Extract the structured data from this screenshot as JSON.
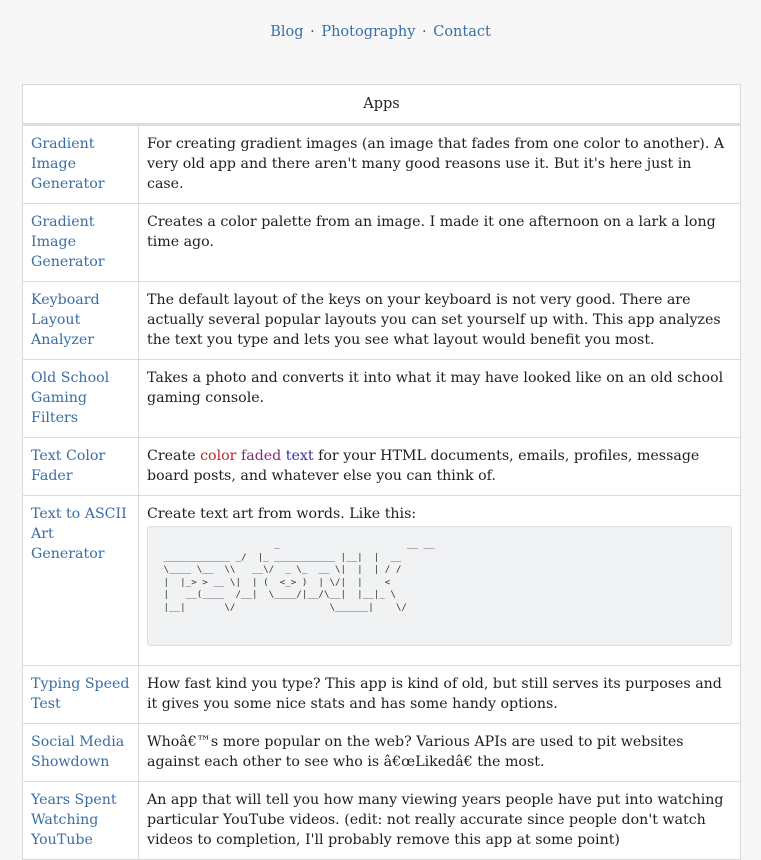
{
  "nav": {
    "links": [
      "Blog",
      "Photography",
      "Contact"
    ],
    "separator": "·"
  },
  "table": {
    "header": "Apps",
    "rows": [
      {
        "name": "Gradient Image Generator",
        "description": "For creating gradient images (an image that fades from one color to another). A very old app and there aren't many good reasons use it. But it's here just in case."
      },
      {
        "name": "Gradient Image Generator",
        "description": "Creates a color palette from an image. I made it one afternoon on a lark a long time ago."
      },
      {
        "name": "Keyboard Layout Analyzer",
        "description": "The default layout of the keys on your keyboard is not very good. There are actually several popular layouts you can set yourself up with. This app analyzes the text you type and lets you see what layout would benefit you most."
      },
      {
        "name": "Old School Gaming Filters",
        "description": "Takes a photo and converts it into what it may have looked like on an old school gaming console."
      },
      {
        "name": "Text Color Fader",
        "description_prefix": "Create ",
        "description_fade": [
          "color",
          "faded",
          "text"
        ],
        "description_suffix": " for your HTML documents, emails, profiles, message board posts, and whatever else you can think of."
      },
      {
        "name": "Text to ASCII Art Generator",
        "description": "Create text art from words. Like this:",
        "ascii_art": "                     _                       __ __\n ____________ _/  |_ ___________ |__|  |  __\n \\____ \\__  \\\\   __\\/  _ \\_  __ \\|  |  | / /\n |  |_> > __ \\|  | (  <_> )  | \\/|  |    <\n |   __(____  /__|  \\____/|__/\\__|  |__|_ \\\n |__|       \\/                 \\______|    \\/"
      },
      {
        "name": "Typing Speed Test",
        "description": "How fast kind you type? This app is kind of old, but still serves its purposes and it gives you some nice stats and has some handy options."
      },
      {
        "name": "Social Media Showdown",
        "description": "Whoâ€™s more popular on the web? Various APIs are used to pit websites against each other to see who is â€œLikedâ€     the most."
      },
      {
        "name": "Years Spent Watching YouTube",
        "description": "An app that will tell you how many viewing years people have put into watching particular YouTube videos. (edit: not really accurate since people don't watch videos to completion, I'll probably remove this app at some point)"
      }
    ]
  },
  "colors": {
    "link": "#3a6ea5",
    "fade_start": "#b8262d",
    "fade_mid": "#7a3070",
    "fade_end": "#3530a8"
  }
}
